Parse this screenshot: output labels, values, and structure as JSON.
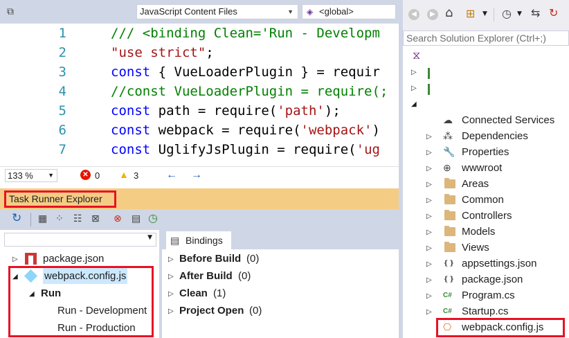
{
  "editor": {
    "nav_project": "JavaScript Content Files",
    "nav_scope": "<global>",
    "lines": [
      {
        "num": "1",
        "tokens": [
          {
            "t": "/// <binding Clean='Run - Developm",
            "c": "cm"
          }
        ]
      },
      {
        "num": "2",
        "tokens": [
          {
            "t": "\"use strict\"",
            "c": "st"
          },
          {
            "t": ";",
            "c": "pl"
          }
        ]
      },
      {
        "num": "3",
        "tokens": [
          {
            "t": "const",
            "c": "kw"
          },
          {
            "t": " { VueLoaderPlugin } = requir",
            "c": "pl"
          }
        ]
      },
      {
        "num": "4",
        "tokens": [
          {
            "t": "//const VueLoaderPlugin = require(;",
            "c": "cm"
          }
        ]
      },
      {
        "num": "5",
        "tokens": [
          {
            "t": "const",
            "c": "kw"
          },
          {
            "t": " path = require(",
            "c": "pl"
          },
          {
            "t": "'path'",
            "c": "st"
          },
          {
            "t": ");",
            "c": "pl"
          }
        ]
      },
      {
        "num": "6",
        "tokens": [
          {
            "t": "const",
            "c": "kw"
          },
          {
            "t": " webpack = require(",
            "c": "pl"
          },
          {
            "t": "'webpack'",
            "c": "st"
          },
          {
            "t": ")",
            "c": "pl"
          }
        ]
      },
      {
        "num": "7",
        "tokens": [
          {
            "t": "const",
            "c": "kw"
          },
          {
            "t": " UglifyJsPlugin = require(",
            "c": "pl"
          },
          {
            "t": "'ug",
            "c": "st"
          }
        ]
      }
    ],
    "zoom": "133 %",
    "errors": "0",
    "warnings": "3"
  },
  "task_runner": {
    "title": "Task Runner Explorer",
    "tree": {
      "package": "package.json",
      "webpack": "webpack.config.js",
      "run": "Run",
      "run_dev": "Run - Development",
      "run_prod": "Run - Production"
    },
    "bindings_tab": "Bindings",
    "bindings": [
      {
        "name": "Before Build",
        "count": "(0)"
      },
      {
        "name": "After Build",
        "count": "(0)"
      },
      {
        "name": "Clean",
        "count": "(1)"
      },
      {
        "name": "Project Open",
        "count": "(0)"
      }
    ]
  },
  "solution_explorer": {
    "search_placeholder": "Search Solution Explorer (Ctrl+;)",
    "items": [
      {
        "label": "Connected Services",
        "icon": "cloud-icon",
        "expandable": false
      },
      {
        "label": "Dependencies",
        "icon": "dependencies-icon",
        "expandable": true
      },
      {
        "label": "Properties",
        "icon": "wrench-icon",
        "expandable": true
      },
      {
        "label": "wwwroot",
        "icon": "globe-icon",
        "expandable": true
      },
      {
        "label": "Areas",
        "icon": "folder-icon",
        "expandable": true
      },
      {
        "label": "Common",
        "icon": "folder-icon",
        "expandable": true
      },
      {
        "label": "Controllers",
        "icon": "folder-icon",
        "expandable": true
      },
      {
        "label": "Models",
        "icon": "folder-icon",
        "expandable": true
      },
      {
        "label": "Views",
        "icon": "folder-icon",
        "expandable": true
      },
      {
        "label": "appsettings.json",
        "icon": "json-file-icon",
        "expandable": true
      },
      {
        "label": "package.json",
        "icon": "json-file-icon",
        "expandable": true
      },
      {
        "label": "Program.cs",
        "icon": "csharp-file-icon",
        "expandable": true
      },
      {
        "label": "Startup.cs",
        "icon": "csharp-file-icon",
        "expandable": true
      },
      {
        "label": "webpack.config.js",
        "icon": "js-file-icon",
        "expandable": false
      }
    ]
  },
  "colors": {
    "highlight_red": "#e81123",
    "tre_header": "#f5cc84",
    "vs_chrome": "#cfd6e5"
  }
}
